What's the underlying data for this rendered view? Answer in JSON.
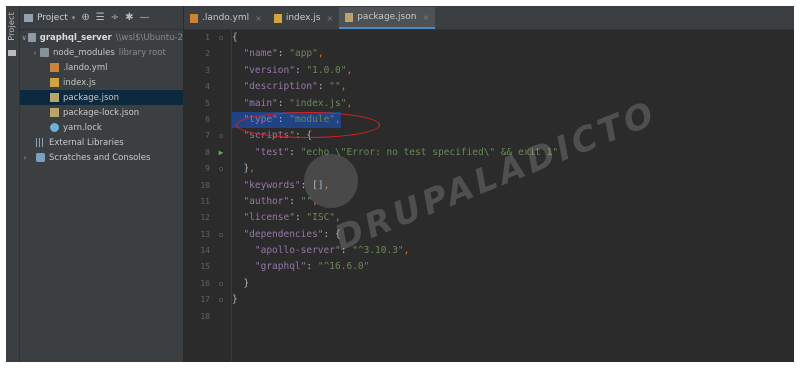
{
  "toolstrip": {
    "label": "Project"
  },
  "project_panel": {
    "title": "Project",
    "icons": [
      "target-icon",
      "collapse-icon",
      "expand-icon",
      "gear-icon",
      "minimize-icon"
    ],
    "tree": [
      {
        "label": "graphql_server",
        "suffix": "\\\\wsl$\\Ubuntu-2",
        "icon": "folder-icon",
        "expanded": true
      },
      {
        "label": "node_modules",
        "suffix": "library root",
        "icon": "folder-icon",
        "expanded": false
      },
      {
        "label": ".lando.yml",
        "icon": "yml-file-icon"
      },
      {
        "label": "index.js",
        "icon": "js-file-icon"
      },
      {
        "label": "package.json",
        "icon": "json-file-icon",
        "selected": true
      },
      {
        "label": "package-lock.json",
        "icon": "json-file-icon"
      },
      {
        "label": "yarn.lock",
        "icon": "yarn-icon"
      },
      {
        "label": "External Libraries",
        "icon": "library-icon"
      },
      {
        "label": "Scratches and Consoles",
        "icon": "scratch-icon"
      }
    ]
  },
  "tabs": [
    {
      "label": ".lando.yml",
      "close": "×"
    },
    {
      "label": "index.js",
      "close": "×"
    },
    {
      "label": "package.json",
      "close": "×",
      "active": true
    }
  ],
  "code": {
    "line_numbers": [
      "1",
      "2",
      "3",
      "4",
      "5",
      "6",
      "7",
      "8",
      "9",
      "10",
      "11",
      "12",
      "13",
      "14",
      "15",
      "16",
      "17",
      "18"
    ],
    "lines": [
      "{",
      "  \"name\": \"app\",",
      "  \"version\": \"1.0.0\",",
      "  \"description\": \"\",",
      "  \"main\": \"index.js\",",
      "  \"type\": \"module\",",
      "  \"scripts\": {",
      "    \"test\": \"echo \\\"Error: no test specified\\\" && exit 1\"",
      "  },",
      "  \"keywords\": [],",
      "  \"author\": \"\",",
      "  \"license\": \"ISC\",",
      "  \"dependencies\": {",
      "    \"apollo-server\": \"^3.10.3\",",
      "    \"graphql\": \"^16.6.0\"",
      "  }",
      "}",
      ""
    ],
    "highlighted_line": 6
  },
  "watermark": {
    "text": "DRUPALADICTO"
  }
}
